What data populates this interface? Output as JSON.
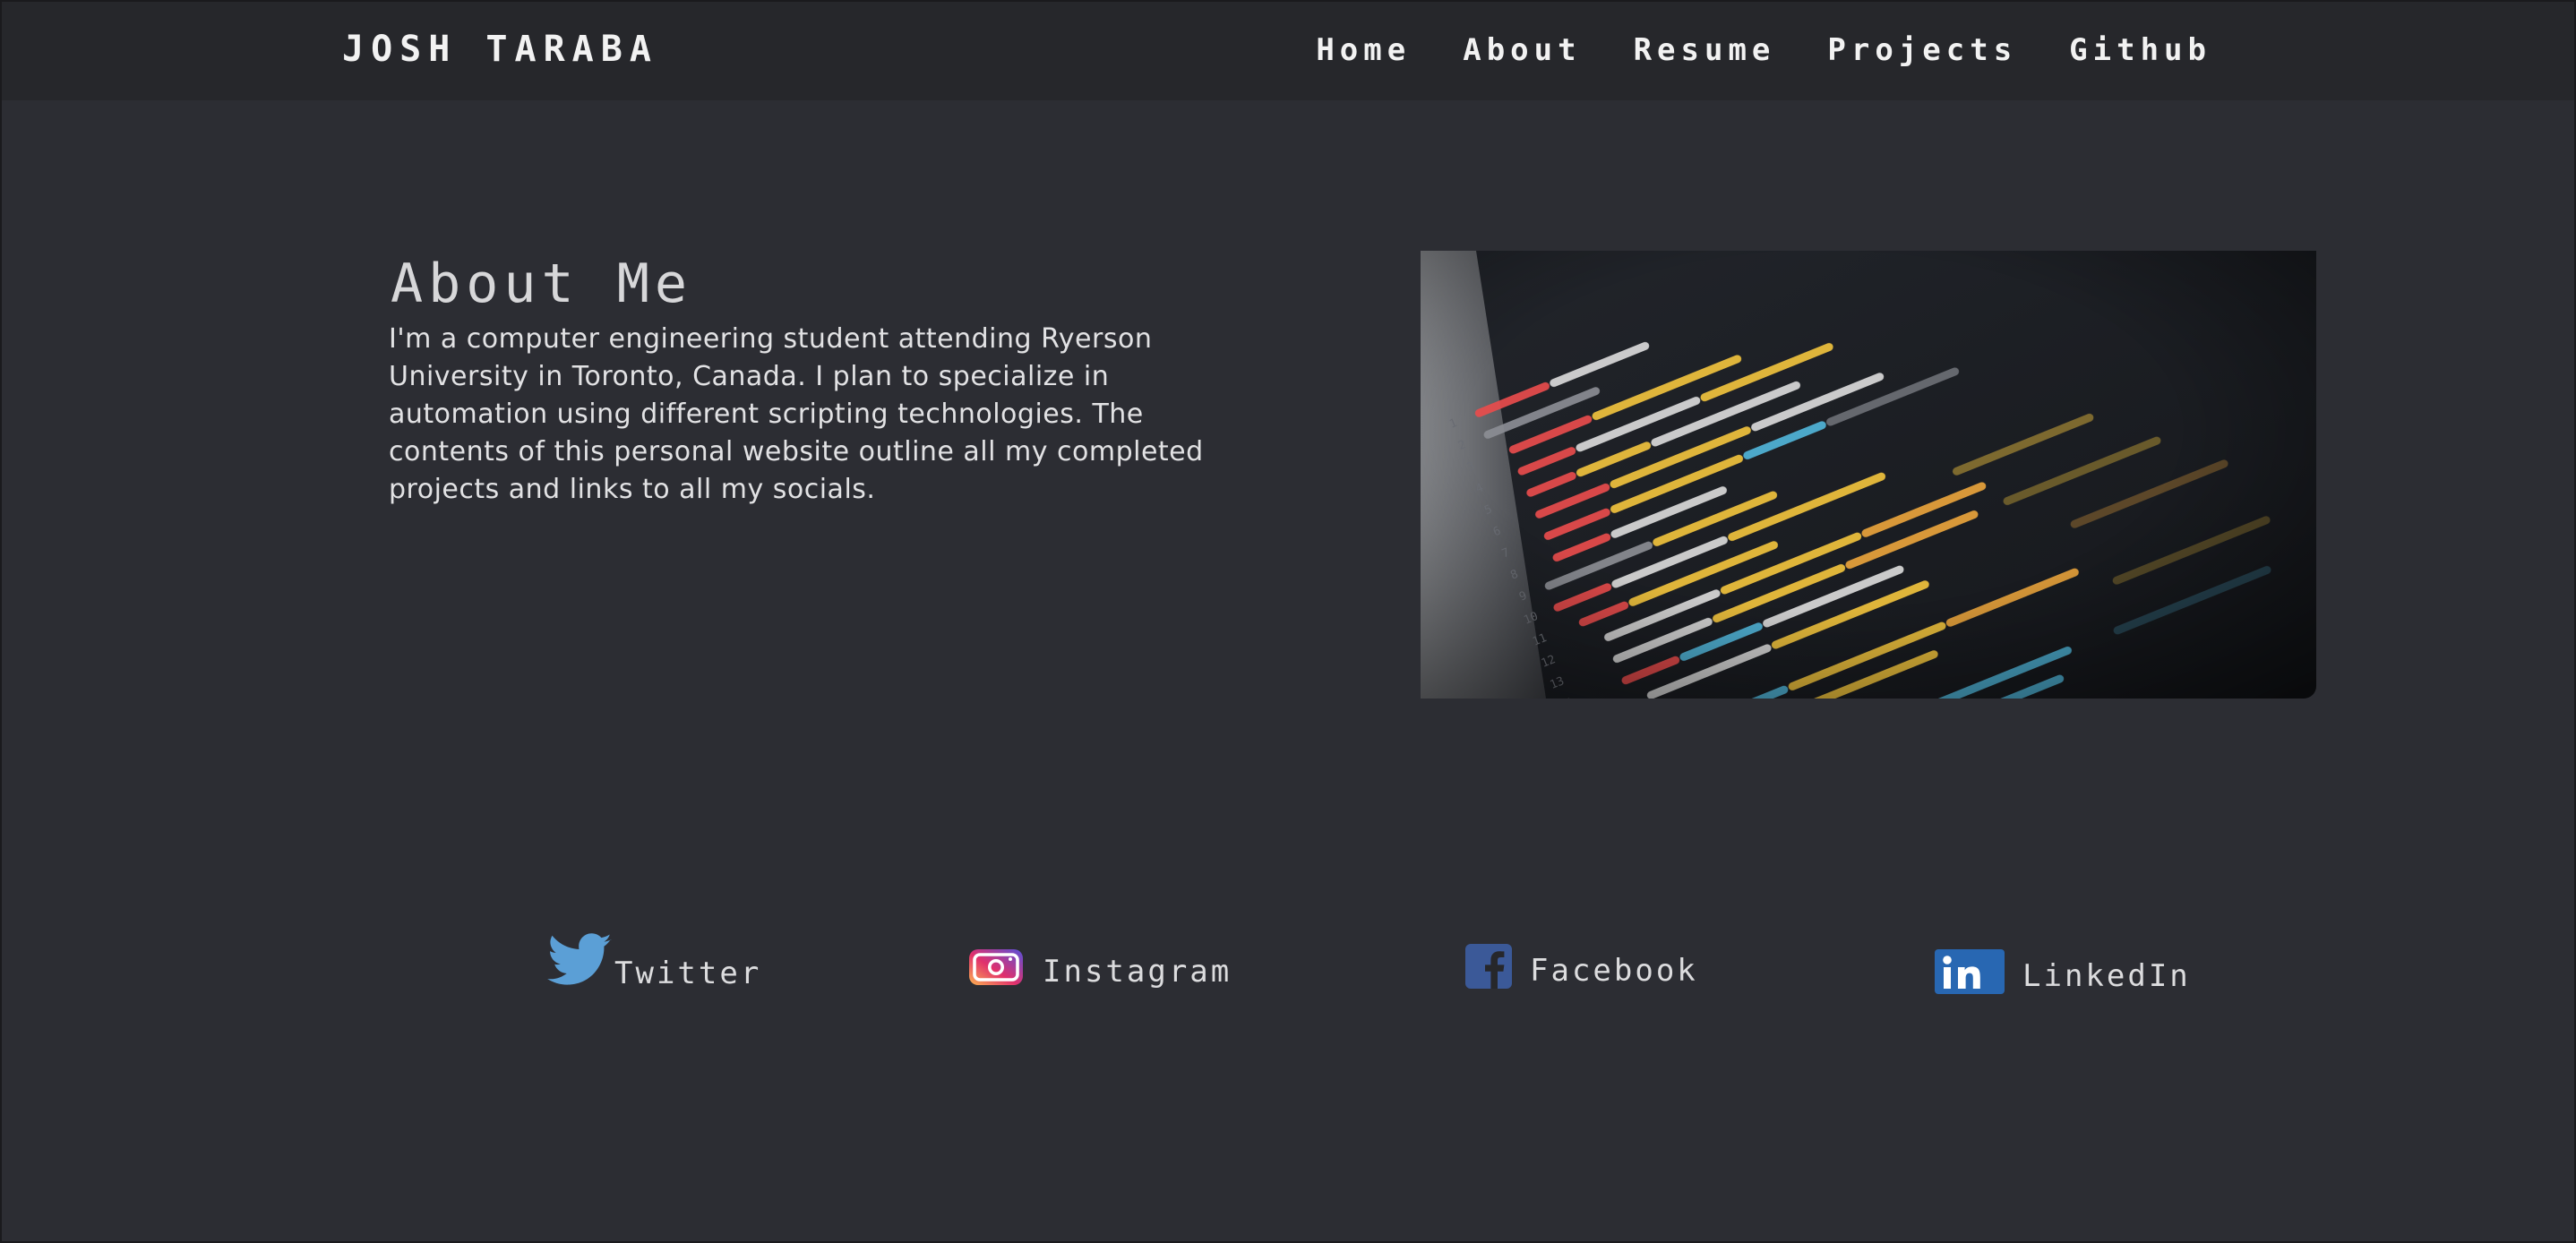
{
  "header": {
    "brand": "JOSH TARABA",
    "nav": [
      {
        "label": "Home"
      },
      {
        "label": "About"
      },
      {
        "label": "Resume"
      },
      {
        "label": "Projects"
      },
      {
        "label": "Github"
      }
    ]
  },
  "about": {
    "title": "About Me",
    "text": "I'm a computer engineering student attending Ryerson University in Toronto, Canada. I plan to specialize in automation using different scripting technologies. The contents of this personal website outline all my completed projects and links to all my socials."
  },
  "image": {
    "icon": "code-editor-screenshot"
  },
  "socials": [
    {
      "label": "Twitter",
      "icon": "twitter-icon",
      "color": "#5b9fd6"
    },
    {
      "label": "Instagram",
      "icon": "instagram-icon",
      "color": "#c13584"
    },
    {
      "label": "Facebook",
      "icon": "facebook-icon",
      "color": "#3b5998"
    },
    {
      "label": "LinkedIn",
      "icon": "linkedin-icon",
      "color": "#2867b2"
    }
  ],
  "colors": {
    "background": "#2c2d33",
    "navbar": "#26272b",
    "text": "#e2e2e4"
  }
}
